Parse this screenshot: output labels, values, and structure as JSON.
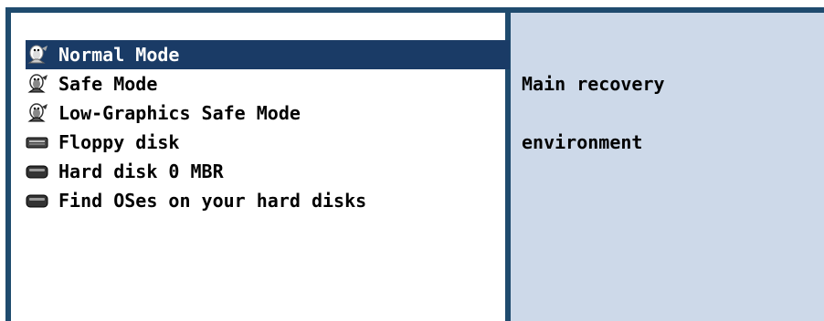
{
  "menu": {
    "items": [
      {
        "label": "Normal Mode",
        "icon": "penguin-icon",
        "selected": true
      },
      {
        "label": "Safe Mode",
        "icon": "penguin-icon",
        "selected": false
      },
      {
        "label": "Low-Graphics Safe Mode",
        "icon": "penguin-icon",
        "selected": false
      },
      {
        "label": "Floppy disk",
        "icon": "floppy-drive-icon",
        "selected": false
      },
      {
        "label": "Hard disk 0 MBR",
        "icon": "hard-disk-icon",
        "selected": false
      },
      {
        "label": "Find OSes on your hard disks",
        "icon": "hard-disk-icon",
        "selected": false
      }
    ]
  },
  "description": {
    "line1": "Main recovery",
    "line2": "environment"
  },
  "colors": {
    "border": "#1f4b6e",
    "selection": "#1a3b66",
    "info_panel": "#cdd9e9"
  }
}
